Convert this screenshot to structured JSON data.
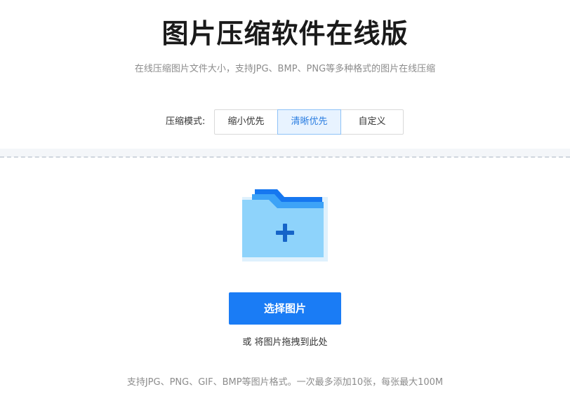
{
  "header": {
    "title": "图片压缩软件在线版",
    "subtitle": "在线压缩图片文件大小，支持JPG、BMP、PNG等多种格式的图片在线压缩"
  },
  "mode": {
    "label": "压缩模式:",
    "options": [
      {
        "label": "缩小优先",
        "active": false
      },
      {
        "label": "清晰优先",
        "active": true
      },
      {
        "label": "自定义",
        "active": false
      }
    ]
  },
  "upload": {
    "icon": "folder-add-icon",
    "button_label": "选择图片",
    "drag_hint": "或 将图片拖拽到此处"
  },
  "footer": {
    "note": "支持JPG、PNG、GIF、BMP等图片格式。一次最多添加10张，每张最大100M"
  },
  "colors": {
    "accent": "#1a7cf5",
    "active_bg": "#e8f3ff",
    "active_text": "#2a7de1"
  }
}
